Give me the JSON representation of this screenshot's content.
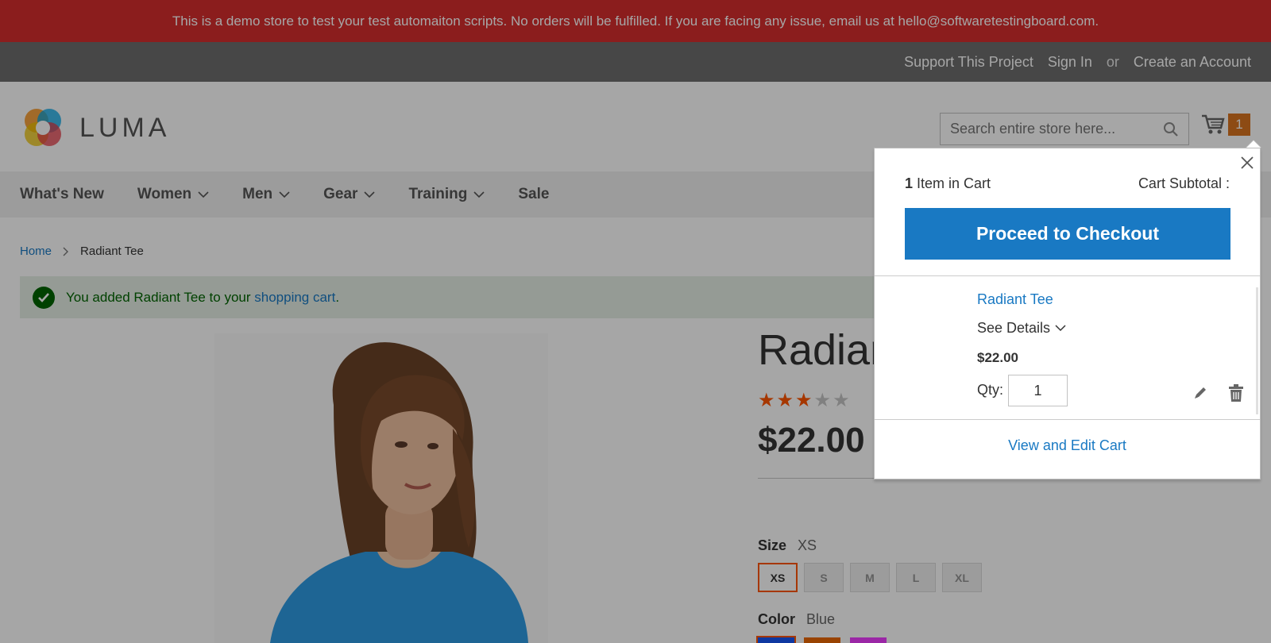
{
  "demo_notice": "This is a demo store to test your test automaiton scripts. No orders will be fulfilled. If you are facing any issue, email us at hello@softwaretestingboard.com.",
  "header_links": {
    "support": "Support This Project",
    "sign_in": "Sign In",
    "or": "or",
    "create_account": "Create an Account"
  },
  "logo_text": "LUMA",
  "search": {
    "placeholder": "Search entire store here..."
  },
  "cart": {
    "count": "1"
  },
  "nav": [
    {
      "label": "What's New"
    },
    {
      "label": "Women"
    },
    {
      "label": "Men"
    },
    {
      "label": "Gear"
    },
    {
      "label": "Training"
    },
    {
      "label": "Sale"
    }
  ],
  "breadcrumbs": {
    "home": "Home",
    "current": "Radiant Tee"
  },
  "message": {
    "prefix": "You added Radiant Tee to your ",
    "link": "shopping cart",
    "suffix": "."
  },
  "product": {
    "title": "Radiant Tee",
    "price": "$22.00",
    "rating": 3,
    "rating_max": 5,
    "size_label": "Size",
    "size_value": "XS",
    "sizes": [
      "XS",
      "S",
      "M",
      "L",
      "XL"
    ],
    "color_label": "Color",
    "color_value": "Blue",
    "colors": [
      "#1857f7",
      "#eb6703",
      "#ef3dff"
    ]
  },
  "minicart": {
    "items_count": "1",
    "items_text": "Item in Cart",
    "subtotal_label": "Cart Subtotal :",
    "checkout_label": "Proceed to Checkout",
    "item_name": "Radiant Tee",
    "see_details": "See Details",
    "item_price": "$22.00",
    "qty_label": "Qty:",
    "qty_value": "1",
    "view_edit": "View and Edit Cart"
  }
}
